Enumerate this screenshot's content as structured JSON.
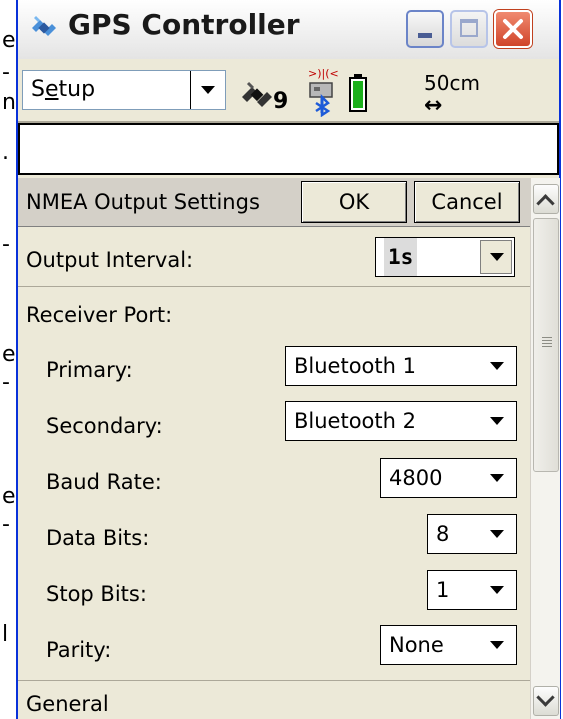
{
  "edge_glyphs": [
    "e",
    "-",
    "n",
    ".",
    "-",
    "e",
    "-",
    "e",
    "-",
    "l"
  ],
  "window": {
    "title": "GPS Controller",
    "controls": {
      "minimize": "minimize",
      "maximize": "maximize",
      "close": "close"
    }
  },
  "toolbar": {
    "menu_prefix": "S",
    "menu_underlined": "e",
    "menu_suffix": "tup",
    "satellite_count": "9",
    "precision_value": "50cm",
    "precision_arrow": "↔"
  },
  "panel": {
    "title": "NMEA Output Settings",
    "ok_label": "OK",
    "cancel_label": "Cancel",
    "output_interval": {
      "label": "Output Interval:",
      "value": "1s"
    },
    "receiver_port_label": "Receiver Port:",
    "fields": {
      "primary": {
        "label": "Primary:",
        "value": "Bluetooth 1"
      },
      "secondary": {
        "label": "Secondary:",
        "value": "Bluetooth 2"
      },
      "baud_rate": {
        "label": "Baud Rate:",
        "value": "4800"
      },
      "data_bits": {
        "label": "Data Bits:",
        "value": "8"
      },
      "stop_bits": {
        "label": "Stop Bits:",
        "value": "1"
      },
      "parity": {
        "label": "Parity:",
        "value": "None"
      }
    },
    "general_label": "General"
  },
  "colors": {
    "window_border": "#0831d9",
    "panel_bg": "#ece9d8",
    "close_button": "#d0452a"
  }
}
